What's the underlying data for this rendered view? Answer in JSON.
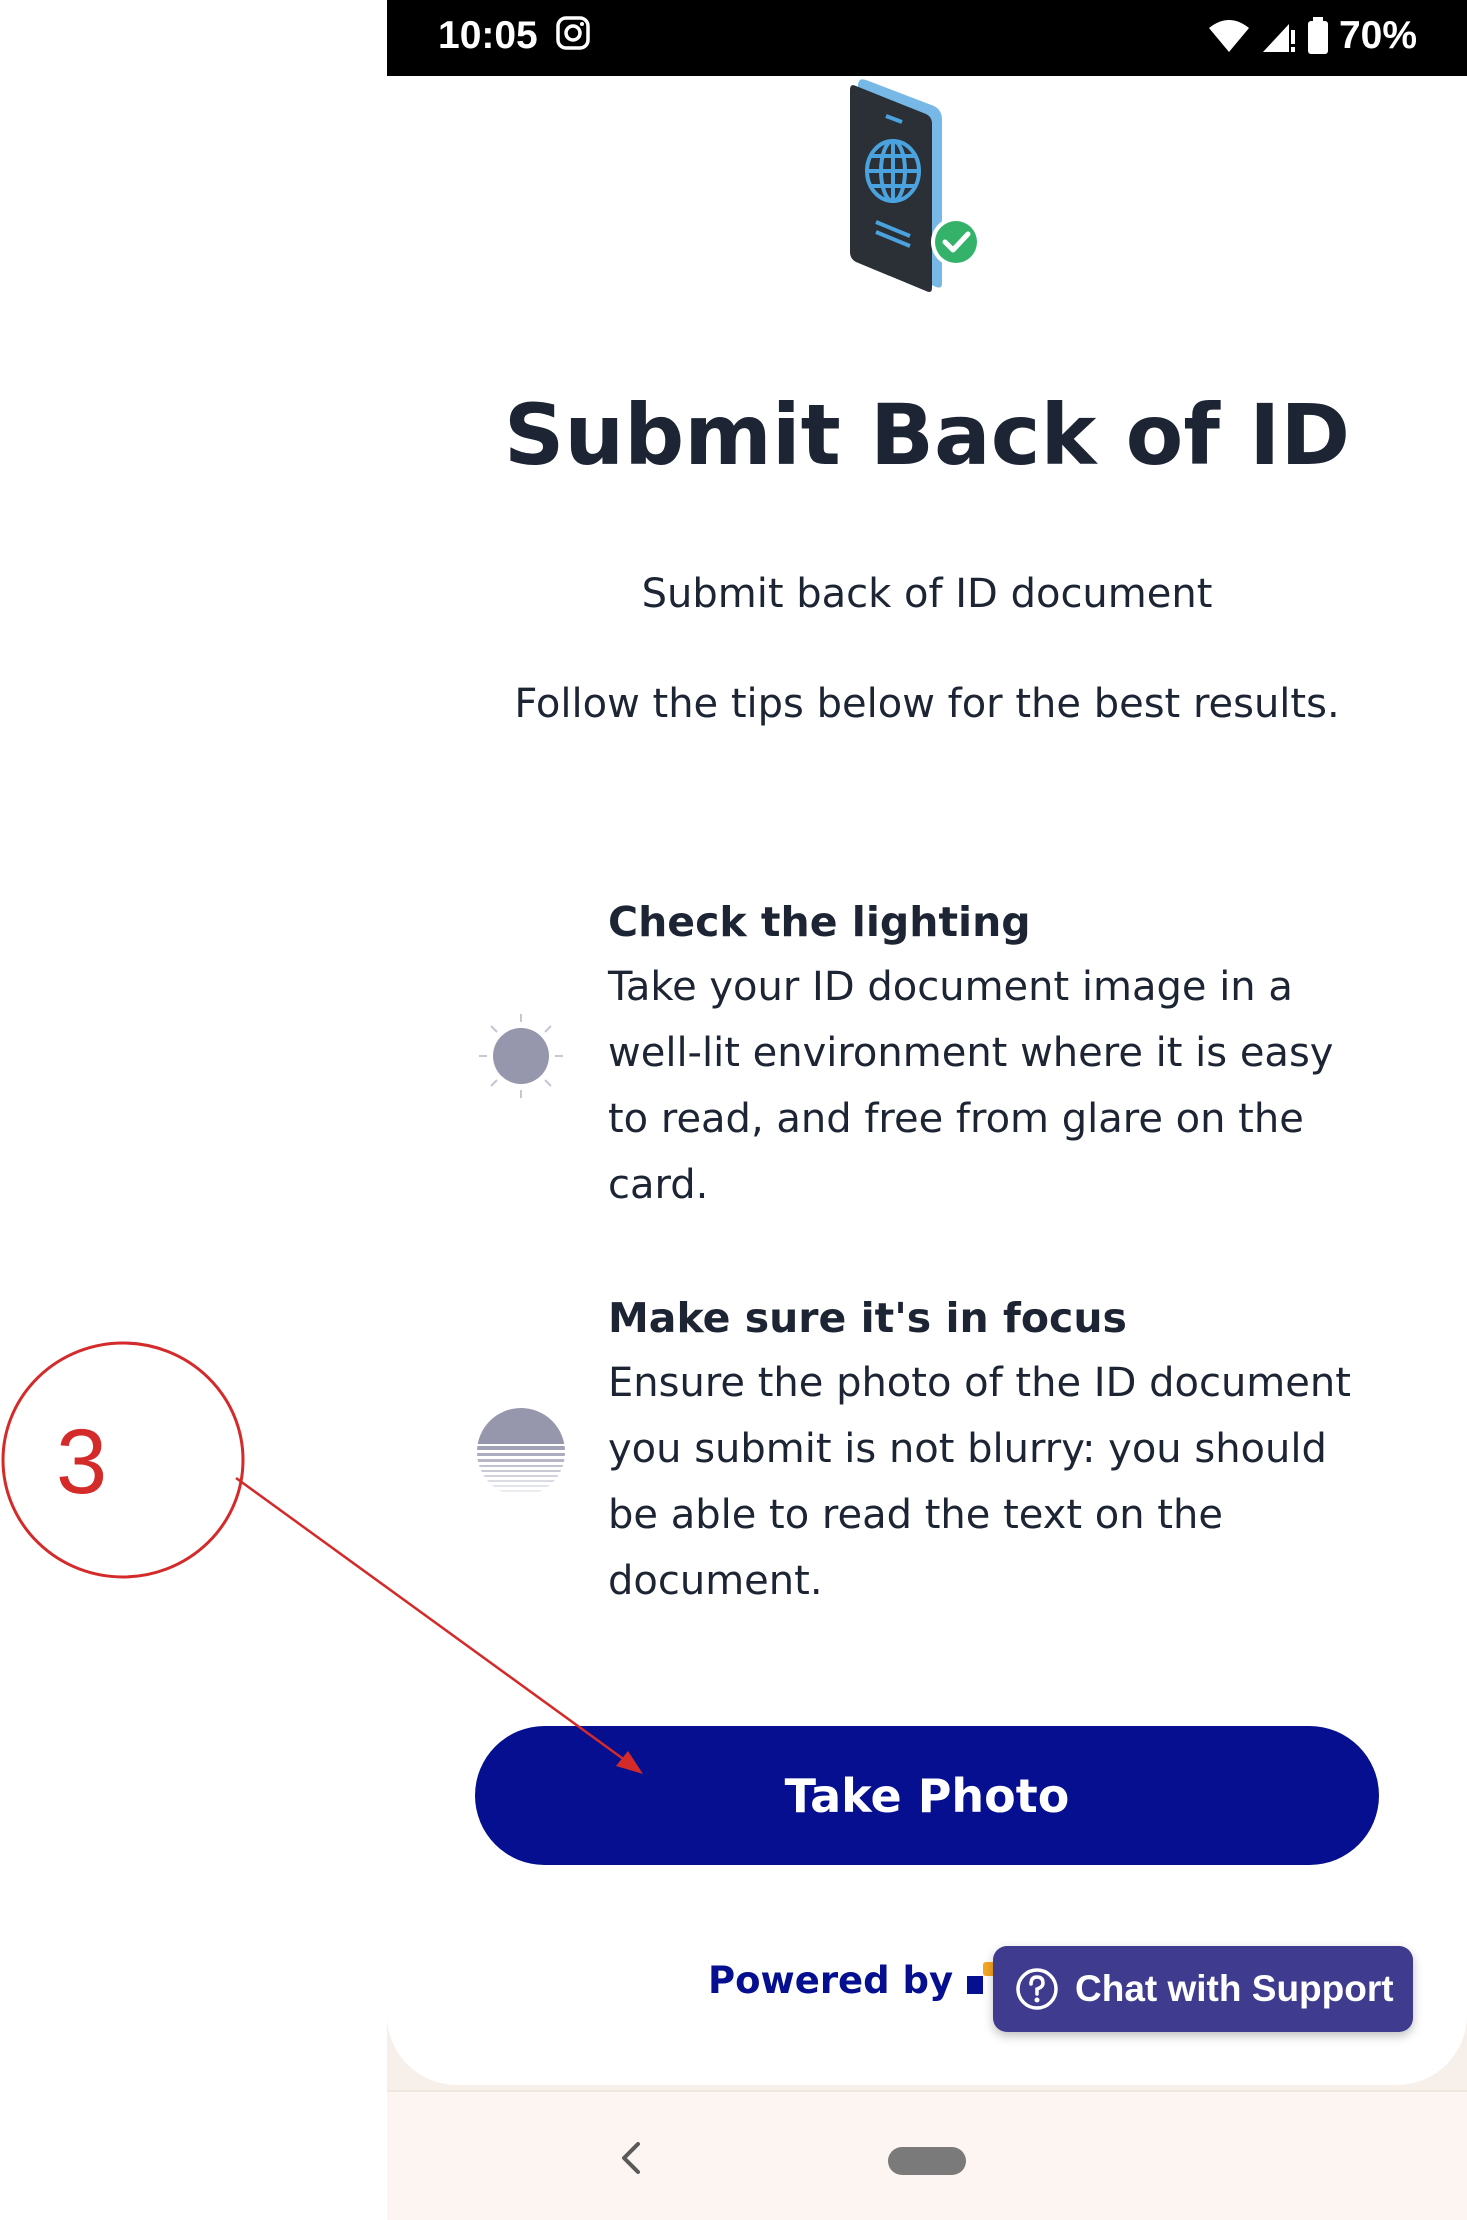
{
  "status_bar": {
    "time": "10:05",
    "battery": "70%",
    "icons": [
      "instagram-icon",
      "wifi-icon",
      "signal-icon",
      "battery-icon"
    ]
  },
  "header": {
    "title": "Submit Back of ID",
    "subtitle": "Submit back of ID document",
    "intro": "Follow the tips below for the best results."
  },
  "tips": [
    {
      "icon": "sun-icon",
      "heading": "Check the lighting",
      "body_lines": [
        "Take your ID document image in a",
        "well-lit environment where it is easy",
        "to read, and free from glare on the",
        "card."
      ]
    },
    {
      "icon": "blur-icon",
      "heading": "Make sure it's in focus",
      "body_lines": [
        "Ensure the photo of the ID document",
        "you submit is not blurry: you should",
        "be able to read the text on the",
        "document."
      ]
    }
  ],
  "actions": {
    "take_photo_label": "Take Photo"
  },
  "footer": {
    "powered_by": "Powered by",
    "chat_label": "Chat with Support"
  },
  "annotation": {
    "number": "3"
  },
  "colors": {
    "primary": "#050f8f",
    "chat": "#3f3b8f",
    "annotation": "#d42a2a",
    "text": "#1d2433"
  }
}
